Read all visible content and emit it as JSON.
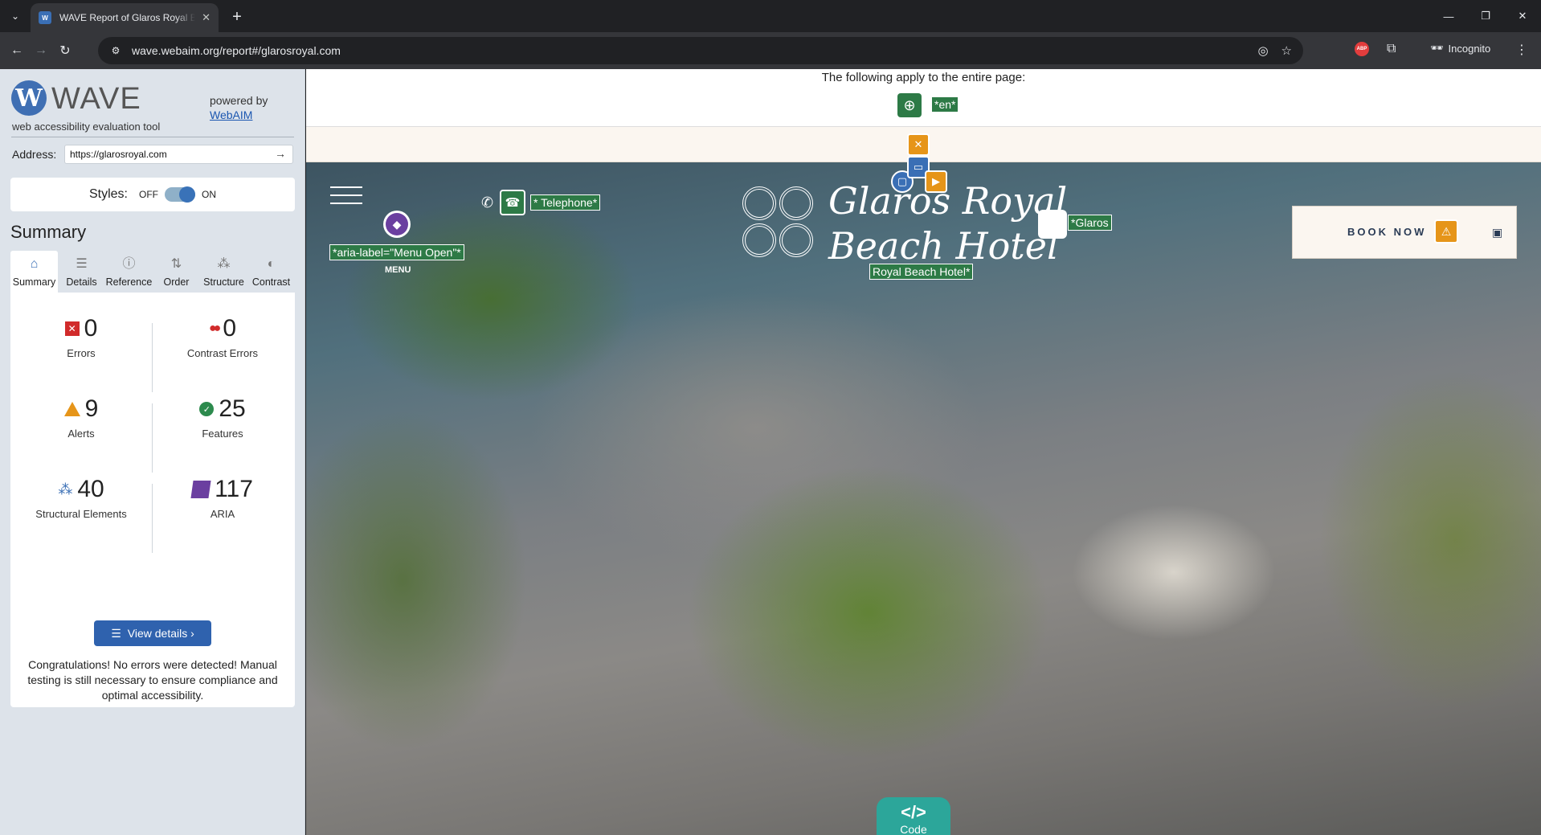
{
  "browser": {
    "tab_title": "WAVE Report of Glaros Royal Beach Hotel",
    "favicon_text": "W",
    "url": "wave.webaim.org/report#/glarosroyal.com",
    "incognito_label": "Incognito",
    "abp_label": "ABP"
  },
  "wave": {
    "logo_word": "WAVE",
    "tagline": "web accessibility evaluation tool",
    "powered_by": "powered by",
    "webaim_link": "WebAIM",
    "address_label": "Address:",
    "address_value": "https://glarosroyal.com",
    "styles_label": "Styles:",
    "styles_off": "OFF",
    "styles_on": "ON",
    "summary_title": "Summary",
    "tabs": [
      {
        "label": "Summary",
        "icon": "home-icon"
      },
      {
        "label": "Details",
        "icon": "list-icon"
      },
      {
        "label": "Reference",
        "icon": "info-icon"
      },
      {
        "label": "Order",
        "icon": "order-icon"
      },
      {
        "label": "Structure",
        "icon": "structure-icon"
      },
      {
        "label": "Contrast",
        "icon": "contrast-icon"
      }
    ],
    "stats": {
      "errors": {
        "value": "0",
        "label": "Errors"
      },
      "contrast_errors": {
        "value": "0",
        "label": "Contrast Errors"
      },
      "alerts": {
        "value": "9",
        "label": "Alerts"
      },
      "features": {
        "value": "25",
        "label": "Features"
      },
      "structural": {
        "value": "40",
        "label": "Structural Elements"
      },
      "aria": {
        "value": "117",
        "label": "ARIA"
      }
    },
    "view_details": "View details ›",
    "congrats": "Congratulations! No errors were detected! Manual testing is still necessary to ensure compliance and optimal accessibility.",
    "colors": {
      "error": "#d12b2b",
      "alert": "#e69519",
      "feature": "#2c8a4d",
      "structure": "#3a6fb5",
      "aria": "#6b3fa0"
    }
  },
  "page": {
    "apply_text": "The following apply to the entire page:",
    "lang_label": "*en*",
    "menu_aria_label": "*aria-label=\"Menu Open\"*",
    "menu_text": "MENU",
    "telephone_label": "* Telephone*",
    "brand_line1": "Glaros Royal",
    "brand_line2": "Beach Hotel",
    "brand_label_1": "*Glaros",
    "brand_label_2": "Royal Beach Hotel*",
    "book_now": "BOOK NOW",
    "code_glyph": "</>",
    "code_label": "Code"
  }
}
